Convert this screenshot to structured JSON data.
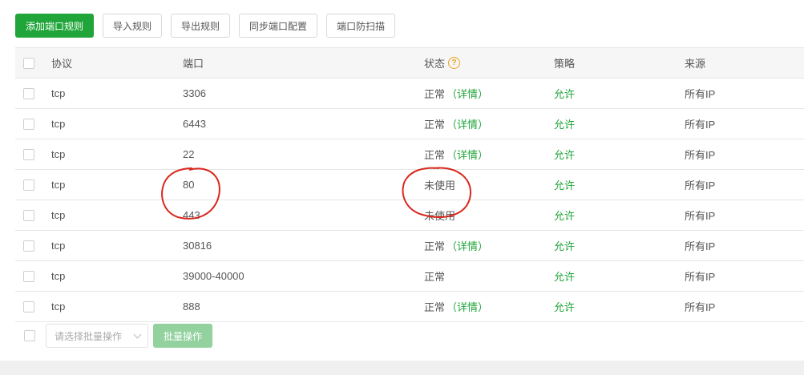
{
  "toolbar": {
    "add": "添加端口规则",
    "import": "导入规则",
    "export": "导出规则",
    "sync": "同步端口配置",
    "scan": "端口防扫描"
  },
  "table": {
    "headers": {
      "protocol": "协议",
      "port": "端口",
      "status": "状态",
      "policy": "策略",
      "source": "来源"
    },
    "help_glyph": "?",
    "rows": [
      {
        "protocol": "tcp",
        "port": "3306",
        "status": "正常",
        "detail": "（详情）",
        "policy": "允许",
        "source": "所有IP"
      },
      {
        "protocol": "tcp",
        "port": "6443",
        "status": "正常",
        "detail": "（详情）",
        "policy": "允许",
        "source": "所有IP"
      },
      {
        "protocol": "tcp",
        "port": "22",
        "status": "正常",
        "detail": "（详情）",
        "policy": "允许",
        "source": "所有IP"
      },
      {
        "protocol": "tcp",
        "port": "80",
        "status": "未使用",
        "detail": "",
        "policy": "允许",
        "source": "所有IP"
      },
      {
        "protocol": "tcp",
        "port": "443",
        "status": "未使用",
        "detail": "",
        "policy": "允许",
        "source": "所有IP"
      },
      {
        "protocol": "tcp",
        "port": "30816",
        "status": "正常",
        "detail": "（详情）",
        "policy": "允许",
        "source": "所有IP"
      },
      {
        "protocol": "tcp",
        "port": "39000-40000",
        "status": "正常",
        "detail": "",
        "policy": "允许",
        "source": "所有IP"
      },
      {
        "protocol": "tcp",
        "port": "888",
        "status": "正常",
        "detail": "（详情）",
        "policy": "允许",
        "source": "所有IP"
      }
    ]
  },
  "footer": {
    "batch_placeholder": "请选择批量操作",
    "batch_button": "批量操作"
  },
  "colors": {
    "primary": "#20a53a",
    "help": "#f0a020",
    "annotation": "#d9281e"
  }
}
